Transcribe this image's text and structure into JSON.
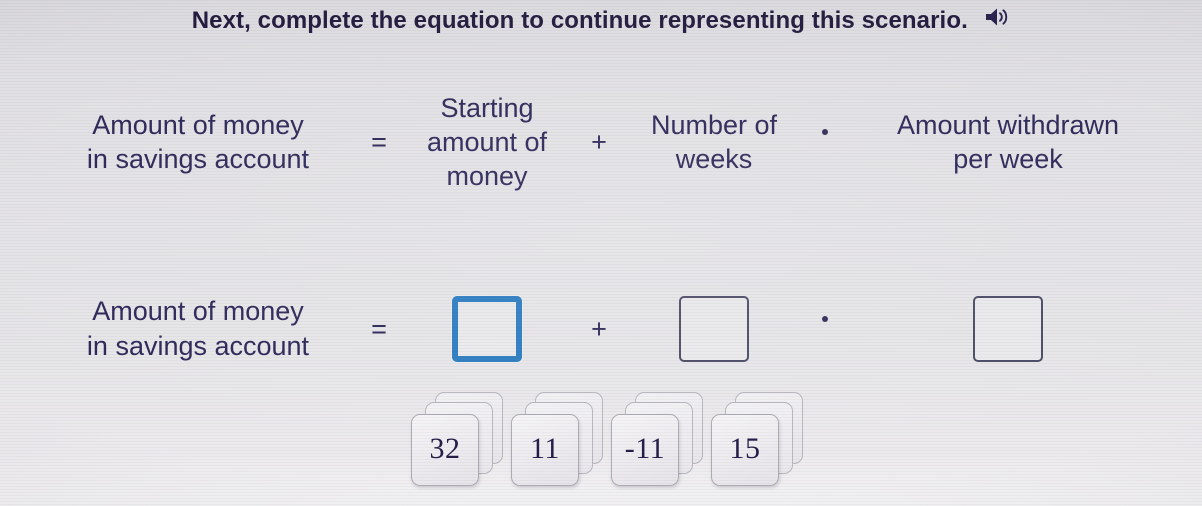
{
  "prompt": {
    "text": "Next, complete the equation to continue representing this scenario.",
    "audio_icon": "speaker-icon"
  },
  "word_equation": {
    "left_term": "Amount of money in savings account",
    "left_term_line1": "Amount of money",
    "left_term_line2": "in savings account",
    "equals": "=",
    "starting_amount_line1": "Starting",
    "starting_amount_line2": "amount of",
    "starting_amount_line3": "money",
    "plus": "+",
    "weeks_line1": "Number of",
    "weeks_line2": "weeks",
    "times": "·",
    "withdrawn_line1": "Amount withdrawn",
    "withdrawn_line2": "per week"
  },
  "answer_equation": {
    "left_label_line1": "Amount of money",
    "left_label_line2": "in savings account",
    "equals": "=",
    "plus": "+",
    "times": "·",
    "blanks": [
      {
        "name": "blank-starting-amount",
        "value": "",
        "state": "focused"
      },
      {
        "name": "blank-number-of-weeks",
        "value": "",
        "state": "empty"
      },
      {
        "name": "blank-amount-withdrawn",
        "value": "",
        "state": "empty"
      }
    ]
  },
  "answer_tiles": [
    {
      "value": "32"
    },
    {
      "value": "11"
    },
    {
      "value": "-11"
    },
    {
      "value": "15"
    }
  ],
  "colors": {
    "background": "#e3e2e6",
    "text": "#2b2657",
    "heading": "#241c3f",
    "focused_border": "#2a7bc0",
    "blank_border": "#4b4a66",
    "tile_face": "#f1f0f3",
    "tile_text": "#211a46"
  }
}
